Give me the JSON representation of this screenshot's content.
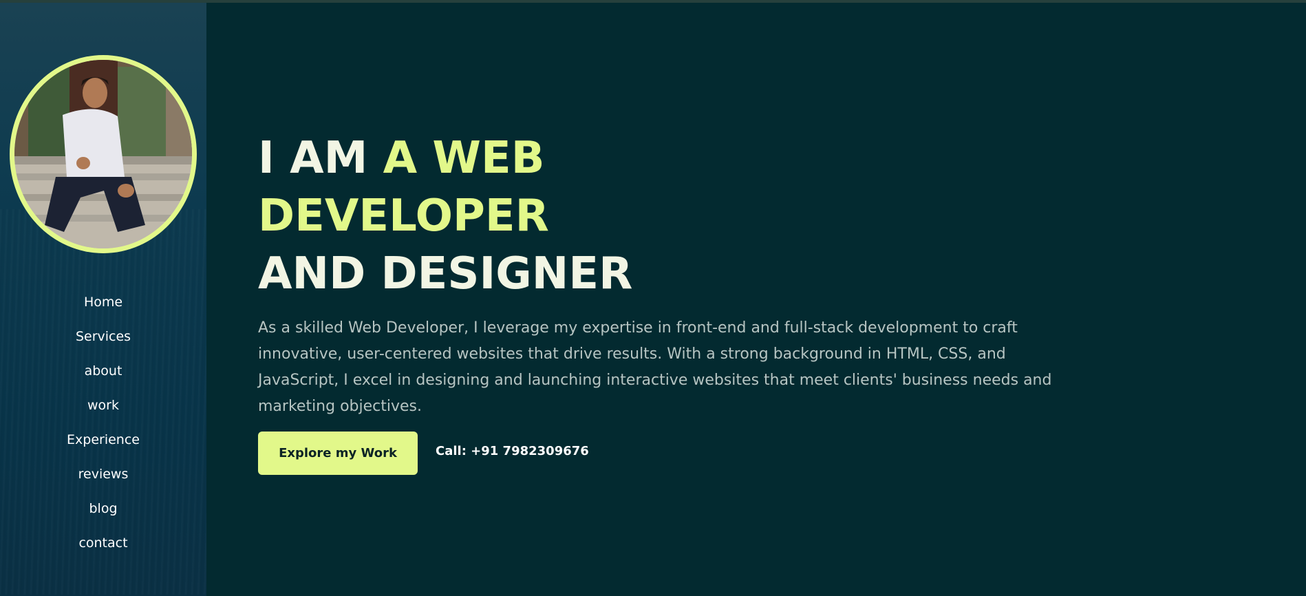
{
  "sidebar": {
    "items": [
      {
        "label": "Home"
      },
      {
        "label": "Services"
      },
      {
        "label": "about"
      },
      {
        "label": "work"
      },
      {
        "label": "Experience"
      },
      {
        "label": "reviews"
      },
      {
        "label": "blog"
      },
      {
        "label": "contact"
      }
    ]
  },
  "hero": {
    "headline_part1": "I AM ",
    "headline_accent_1": "A WEB",
    "headline_accent_2": "DEVELOPER",
    "headline_part3": "AND DESIGNER",
    "description": "As a skilled Web Developer, I leverage my expertise in front-end and full-stack development to craft innovative, user-centered websites that drive results. With a strong background in HTML, CSS, and JavaScript, I excel in designing and launching interactive websites that meet clients' business needs and marketing objectives.",
    "cta_label": "Explore my Work",
    "call_label": "Call: +91 7982309676"
  },
  "colors": {
    "accent": "#e2f88a",
    "background": "#032a30",
    "sidebar": "#0c3a4f"
  }
}
